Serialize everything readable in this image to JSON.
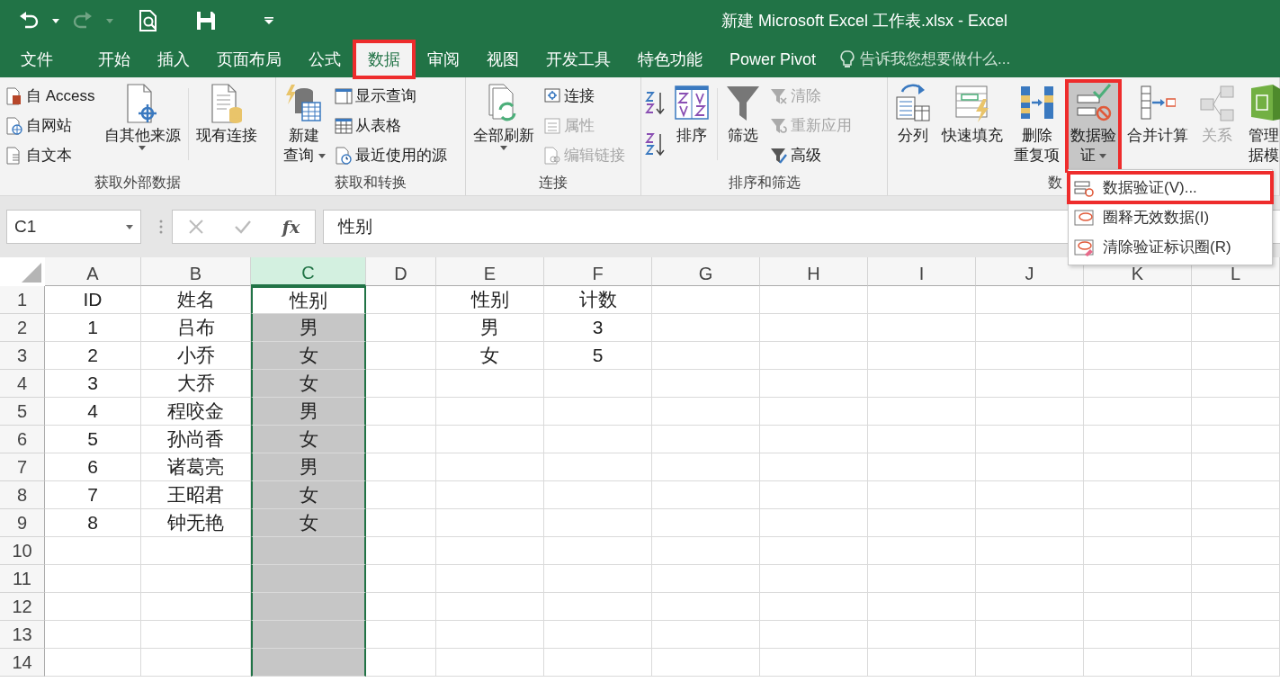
{
  "window": {
    "title": "新建 Microsoft Excel 工作表.xlsx - Excel"
  },
  "tabs": [
    {
      "label": "文件",
      "selected": false,
      "highlighted": false
    },
    {
      "label": "开始",
      "selected": false,
      "highlighted": false
    },
    {
      "label": "插入",
      "selected": false,
      "highlighted": false
    },
    {
      "label": "页面布局",
      "selected": false,
      "highlighted": false
    },
    {
      "label": "公式",
      "selected": false,
      "highlighted": false
    },
    {
      "label": "数据",
      "selected": true,
      "highlighted": true
    },
    {
      "label": "审阅",
      "selected": false,
      "highlighted": false
    },
    {
      "label": "视图",
      "selected": false,
      "highlighted": false
    },
    {
      "label": "开发工具",
      "selected": false,
      "highlighted": false
    },
    {
      "label": "特色功能",
      "selected": false,
      "highlighted": false
    },
    {
      "label": "Power Pivot",
      "selected": false,
      "highlighted": false
    }
  ],
  "tell_me": {
    "placeholder": "告诉我您想要做什么..."
  },
  "ribbon": {
    "groups": [
      {
        "label": "获取外部数据",
        "items": [
          {
            "kind": "stack",
            "items": [
              {
                "label": "自 Access",
                "disabled": false
              },
              {
                "label": "自网站",
                "disabled": false
              },
              {
                "label": "自文本",
                "disabled": false
              }
            ]
          },
          {
            "kind": "large",
            "lines": [
              "自其他来源"
            ],
            "dropdown": true,
            "disabled": false,
            "pressed": false,
            "highlighted": false
          },
          {
            "kind": "large",
            "lines": [
              "现有连接"
            ],
            "dropdown": false,
            "disabled": false,
            "pressed": false,
            "highlighted": false
          }
        ]
      },
      {
        "label": "获取和转换",
        "items": [
          {
            "kind": "large",
            "lines": [
              "新建",
              "查询"
            ],
            "dropdown": true,
            "disabled": false,
            "pressed": false,
            "highlighted": false
          },
          {
            "kind": "stack",
            "items": [
              {
                "label": "显示查询",
                "disabled": false
              },
              {
                "label": "从表格",
                "disabled": false
              },
              {
                "label": "最近使用的源",
                "disabled": false
              }
            ]
          }
        ]
      },
      {
        "label": "连接",
        "items": [
          {
            "kind": "large",
            "lines": [
              "全部刷新"
            ],
            "dropdown": true,
            "disabled": false,
            "pressed": false,
            "highlighted": false
          },
          {
            "kind": "stack",
            "items": [
              {
                "label": "连接",
                "disabled": false
              },
              {
                "label": "属性",
                "disabled": true
              },
              {
                "label": "编辑链接",
                "disabled": true
              }
            ]
          }
        ]
      },
      {
        "label": "排序和筛选",
        "items": [
          {
            "kind": "sortstack"
          },
          {
            "kind": "large",
            "lines": [
              "排序"
            ],
            "dropdown": false,
            "disabled": false,
            "pressed": false,
            "highlighted": false
          },
          {
            "kind": "large",
            "lines": [
              "筛选"
            ],
            "dropdown": false,
            "disabled": false,
            "pressed": false,
            "highlighted": false
          },
          {
            "kind": "stack",
            "items": [
              {
                "label": "清除",
                "disabled": true
              },
              {
                "label": "重新应用",
                "disabled": true
              },
              {
                "label": "高级",
                "disabled": false
              }
            ]
          }
        ]
      },
      {
        "label": "数",
        "items": [
          {
            "kind": "large",
            "lines": [
              "分列"
            ],
            "dropdown": false,
            "disabled": false,
            "pressed": false,
            "highlighted": false
          },
          {
            "kind": "large",
            "lines": [
              "快速填充"
            ],
            "dropdown": false,
            "disabled": false,
            "pressed": false,
            "highlighted": false
          },
          {
            "kind": "large",
            "lines": [
              "删除",
              "重复项"
            ],
            "dropdown": false,
            "disabled": false,
            "pressed": false,
            "highlighted": false
          },
          {
            "kind": "large",
            "lines": [
              "数据验",
              "证"
            ],
            "dropdown": true,
            "disabled": false,
            "pressed": true,
            "highlighted": true
          },
          {
            "kind": "large",
            "lines": [
              "合并计算"
            ],
            "dropdown": false,
            "disabled": false,
            "pressed": false,
            "highlighted": false
          },
          {
            "kind": "large",
            "lines": [
              "关系"
            ],
            "dropdown": false,
            "disabled": true,
            "pressed": false,
            "highlighted": false
          },
          {
            "kind": "large",
            "lines": [
              "管理",
              "据模"
            ],
            "dropdown": false,
            "disabled": false,
            "pressed": false,
            "highlighted": false
          }
        ]
      }
    ]
  },
  "dropdown_menu": {
    "items": [
      {
        "label": "数据验证(V)...",
        "highlighted": true
      },
      {
        "label": "圈释无效数据(I)",
        "highlighted": false
      },
      {
        "label": "清除验证标识圈(R)",
        "highlighted": false
      }
    ]
  },
  "formula_bar": {
    "name_box": "C1",
    "function_label": "fx",
    "value": "性别"
  },
  "sheet": {
    "columns": [
      {
        "label": "A",
        "selected": false
      },
      {
        "label": "B",
        "selected": false
      },
      {
        "label": "C",
        "selected": true
      },
      {
        "label": "D",
        "selected": false
      },
      {
        "label": "E",
        "selected": false
      },
      {
        "label": "F",
        "selected": false
      },
      {
        "label": "G",
        "selected": false
      },
      {
        "label": "H",
        "selected": false
      },
      {
        "label": "I",
        "selected": false
      },
      {
        "label": "J",
        "selected": false
      },
      {
        "label": "K",
        "selected": false
      },
      {
        "label": "L",
        "selected": false
      }
    ],
    "rows": [
      {
        "number": "1",
        "cells": [
          "ID",
          "姓名",
          "性别",
          null,
          "性别",
          "计数"
        ]
      },
      {
        "number": "2",
        "cells": [
          "1",
          "吕布",
          "男",
          null,
          "男",
          "3"
        ]
      },
      {
        "number": "3",
        "cells": [
          "2",
          "小乔",
          "女",
          null,
          "女",
          "5"
        ]
      },
      {
        "number": "4",
        "cells": [
          "3",
          "大乔",
          "女"
        ]
      },
      {
        "number": "5",
        "cells": [
          "4",
          "程咬金",
          "男"
        ]
      },
      {
        "number": "6",
        "cells": [
          "5",
          "孙尚香",
          "女"
        ]
      },
      {
        "number": "7",
        "cells": [
          "6",
          "诸葛亮",
          "男"
        ]
      },
      {
        "number": "8",
        "cells": [
          "7",
          "王昭君",
          "女"
        ]
      },
      {
        "number": "9",
        "cells": [
          "8",
          "钟无艳",
          "女"
        ]
      },
      {
        "number": "10"
      },
      {
        "number": "11"
      },
      {
        "number": "12"
      },
      {
        "number": "13"
      },
      {
        "number": "14"
      }
    ]
  }
}
